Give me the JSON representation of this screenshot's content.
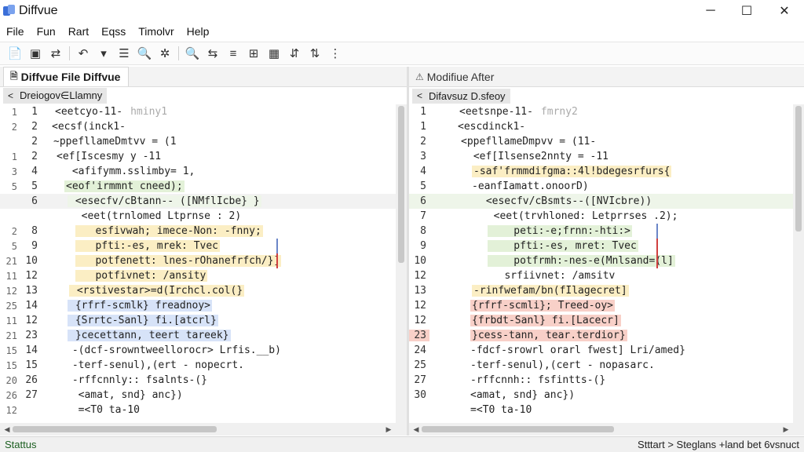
{
  "window": {
    "title": "Diffvue",
    "controls": {
      "minimize": "─",
      "maximize": "☐",
      "close": "✕"
    }
  },
  "menu": [
    "File",
    "Fun",
    "Rart",
    "Eqss",
    "Timolvr",
    "Help"
  ],
  "toolbar": [
    "📄",
    "▣",
    "⇄",
    "↶",
    "▾",
    "☰",
    "🔍",
    "✲",
    "🔍",
    "⇆",
    "≡",
    "⊞",
    "▦",
    "⇵",
    "⇅",
    "⋮"
  ],
  "left_pane": {
    "tab_label": "Diffvue File Diffvue",
    "breadcrumb": "Dreiogov∈Llamny",
    "lines": [
      {
        "g1": "1",
        "g2": "1",
        "text": "<eetcyo-11-",
        "tail": "hminy1",
        "bg": ""
      },
      {
        "g1": "2",
        "g2": "2",
        "text": "<ecsf(inck1-",
        "tail": "",
        "bg": ""
      },
      {
        "g1": "",
        "g2": "2",
        "text": "~ppefllameDmtvv = (1",
        "tail": "",
        "bg": ""
      },
      {
        "g1": "1",
        "g2": "2",
        "text": "<ef[Iscesmy y -11",
        "tail": "",
        "bg": ""
      },
      {
        "g1": "3",
        "g2": "4",
        "text": " <afifymm.sslimby= 1,",
        "tail": "",
        "bg": ""
      },
      {
        "g1": "5",
        "g2": "5",
        "text": "<eof'irmmnt cneed);",
        "tail": "",
        "bg": "#e3f1d8"
      },
      {
        "g1": "",
        "g2": "6",
        "text": " <esecfv/cBtann-- ([NMflIcbe} }",
        "tail": "",
        "bg": "#eef5e9"
      },
      {
        "g1": "",
        "g2": "",
        "text": "  <eet(trnlomed Ltprnse : 2)",
        "tail": "",
        "bg": ""
      },
      {
        "g1": "2",
        "g2": "8",
        "text": "   esfivwah; imece-Non: -fnny;",
        "tail": "",
        "bg": ""
      },
      {
        "g1": "5",
        "g2": "9",
        "text": "   pfti:-es, mrek: Tvec",
        "tail": "",
        "bg": ""
      },
      {
        "g1": "21",
        "g2": "10",
        "text": "   potfenett: lnes-rOhanefrfch/}]",
        "tail": "",
        "bg": ""
      },
      {
        "g1": "11",
        "g2": "12",
        "text": "   potfivnet: /ansity",
        "tail": "",
        "bg": ""
      },
      {
        "g1": "12",
        "g2": "13",
        "text": " <rstivestar>=d(Irchcl.col(}",
        "tail": "",
        "bg": ""
      },
      {
        "g1": "25",
        "g2": "14",
        "text": " {rfrf-scmlk} freadnoy>",
        "tail": "",
        "bg": ""
      },
      {
        "g1": "11",
        "g2": "12",
        "text": " {Srrtc-Sanl} fi.[atcrl}",
        "tail": "",
        "bg": ""
      },
      {
        "g1": "21",
        "g2": "23",
        "text": " }cecettann, teert tareek}",
        "tail": "",
        "bg": ""
      },
      {
        "g1": "15",
        "g2": "14",
        "text": " -(dcf-srowntweellorocr> Lrfis.__b)",
        "tail": "",
        "bg": ""
      },
      {
        "g1": "15",
        "g2": "15",
        "text": " -terf-senul),(ert - nopecrt.",
        "tail": "",
        "bg": ""
      },
      {
        "g1": "20",
        "g2": "26",
        "text": " -rffcnnly:: fsalnts-(}",
        "tail": "",
        "bg": ""
      },
      {
        "g1": "26",
        "g2": "27",
        "text": "  <amat, snd} anc})",
        "tail": "",
        "bg": ""
      },
      {
        "g1": "12",
        "g2": "",
        "text": "  =<T0 ta-10",
        "tail": "",
        "bg": ""
      }
    ]
  },
  "right_pane": {
    "tab_label": "Modifiue After",
    "breadcrumb": "Difavsuz D.sfeoy",
    "lines": [
      {
        "g2": "1",
        "text": "<eetsnpe-11-",
        "tail": "fmrny2"
      },
      {
        "g2": "1",
        "text": "<escdinck1-",
        "tail": ""
      },
      {
        "g2": "2",
        "text": "<ppefllameDmpvv = (11-",
        "tail": ""
      },
      {
        "g2": "3",
        "text": " <ef[Ilsense2nnty = -11",
        "tail": ""
      },
      {
        "g2": "4",
        "text": "-saf'frmmdifgma::4l!bdegesrfurs{",
        "tail": ""
      },
      {
        "g2": "5",
        "text": "-eanfIamatt.onoorD)",
        "tail": ""
      },
      {
        "g2": "6",
        "text": " <esecfv/cBsmts--([NVIcbre))",
        "tail": ""
      },
      {
        "g2": "7",
        "text": "  <eet(trvhloned: Letprrses .2);",
        "tail": ""
      },
      {
        "g2": "8",
        "text": "    peti:-e;frnn:-hti:>",
        "tail": ""
      },
      {
        "g2": "9",
        "text": "    pfti:-es, mret: Tvec",
        "tail": ""
      },
      {
        "g2": "10",
        "text": "    potfrmh:-nes-e(Mnlsand=(l]",
        "tail": ""
      },
      {
        "g2": "12",
        "text": "   srfiivnet: /amsitv",
        "tail": ""
      },
      {
        "g2": "13",
        "text": "-rinfwefam/bn(fIlagecret]",
        "tail": ""
      },
      {
        "g2": "12",
        "text": "{rfrf-scmli}; Treed-oy>",
        "tail": ""
      },
      {
        "g2": "12",
        "text": "{frbdt-Sanl} fi.[Lacecr]",
        "tail": ""
      },
      {
        "g2": "23",
        "text": "}cess-tann, tear.terdior}",
        "tail": ""
      },
      {
        "g2": "24",
        "text": "-fdcf-srowrl orarl fwest] Lri/amed}",
        "tail": ""
      },
      {
        "g2": "25",
        "text": "-terf-senul),(cert - nopasarc.",
        "tail": ""
      },
      {
        "g2": "27",
        "text": "-rffcnnh:: fsfintts-(}",
        "tail": ""
      },
      {
        "g2": "30",
        "text": "<amat, snd} anc})",
        "tail": ""
      },
      {
        "g2": "",
        "text": "=<T0 ta-10",
        "tail": ""
      }
    ]
  },
  "status": {
    "left": "Stattus",
    "right": "Stttart > Steglans +land bet 6vsnuct"
  },
  "colors": {
    "add": "#e3f1d8",
    "yellow": "#fbeec4",
    "blue": "#d7e3f8",
    "red": "#f8d0c8"
  }
}
